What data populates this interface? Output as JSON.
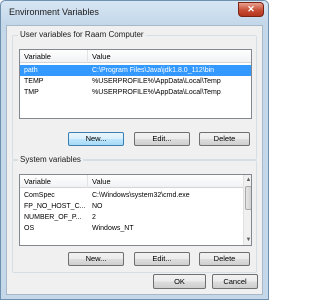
{
  "window": {
    "title": "Environment Variables",
    "close_glyph": "✕"
  },
  "user_vars": {
    "group_label": "User variables for Raam Computer",
    "col_variable": "Variable",
    "col_value": "Value",
    "rows": [
      {
        "variable": "path",
        "value": "C:\\Program Files\\Java\\jdk1.8.0_112\\bin"
      },
      {
        "variable": "TEMP",
        "value": "%USERPROFILE%\\AppData\\Local\\Temp"
      },
      {
        "variable": "TMP",
        "value": "%USERPROFILE%\\AppData\\Local\\Temp"
      }
    ],
    "selected_row": 0,
    "buttons": {
      "new": "New...",
      "edit": "Edit...",
      "delete": "Delete"
    }
  },
  "system_vars": {
    "group_label": "System variables",
    "col_variable": "Variable",
    "col_value": "Value",
    "rows": [
      {
        "variable": "ComSpec",
        "value": "C:\\Windows\\system32\\cmd.exe"
      },
      {
        "variable": "FP_NO_HOST_C...",
        "value": "NO"
      },
      {
        "variable": "NUMBER_OF_P...",
        "value": "2"
      },
      {
        "variable": "OS",
        "value": "Windows_NT"
      }
    ],
    "buttons": {
      "new": "New...",
      "edit": "Edit...",
      "delete": "Delete"
    }
  },
  "dialog_buttons": {
    "ok": "OK",
    "cancel": "Cancel"
  },
  "icons": {
    "scroll_up": "▲",
    "scroll_down": "▼"
  },
  "colors": {
    "selection": "#3399ff",
    "frame": "#c5d8ea",
    "close": "#c84f36"
  }
}
